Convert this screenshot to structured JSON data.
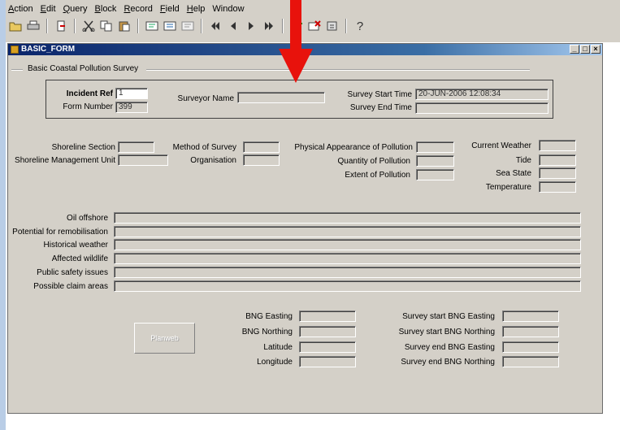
{
  "menubar": {
    "items": [
      {
        "label": "Action",
        "u": 0
      },
      {
        "label": "Edit",
        "u": 0
      },
      {
        "label": "Query",
        "u": 0
      },
      {
        "label": "Block",
        "u": 0
      },
      {
        "label": "Record",
        "u": 0
      },
      {
        "label": "Field",
        "u": 0
      },
      {
        "label": "Help",
        "u": 0
      },
      {
        "label": "Window",
        "u": -1
      }
    ]
  },
  "toolbar": {
    "help_glyph": "?"
  },
  "window": {
    "title": "BASIC_FORM",
    "min_glyph": "_",
    "max_glyph": "□",
    "close_glyph": "×"
  },
  "form": {
    "group_title": "Basic Coastal Pollution Survey",
    "incident": {
      "incident_ref_label": "Incident Ref",
      "incident_ref_value": "1",
      "form_number_label": "Form Number",
      "form_number_value": "399",
      "surveyor_name_label": "Surveyor Name",
      "surveyor_name_value": "",
      "survey_start_label": "Survey Start Time",
      "survey_start_value": "20-JUN-2006 12:08:34",
      "survey_end_label": "Survey End Time",
      "survey_end_value": ""
    },
    "labels": {
      "shoreline_section": "Shoreline Section",
      "shoreline_unit": "Shoreline Management Unit",
      "method_of_survey": "Method of Survey",
      "organisation": "Organisation",
      "physical_appearance": "Physical Appearance of Pollution",
      "quantity": "Quantity of Pollution",
      "extent": "Extent of Pollution",
      "current_weather": "Current Weather",
      "tide": "Tide",
      "sea_state": "Sea State",
      "temperature": "Temperature",
      "oil_offshore": "Oil offshore",
      "potential_remob": "Potential for remobilisation",
      "historical_weather": "Historical weather",
      "affected_wildlife": "Affected wildlife",
      "public_safety": "Public safety issues",
      "possible_claim": "Possible claim areas",
      "bng_easting": "BNG Easting",
      "bng_northing": "BNG Northing",
      "latitude": "Latitude",
      "longitude": "Longitude",
      "start_bng_easting": "Survey start BNG Easting",
      "start_bng_northing": "Survey start BNG Northing",
      "end_bng_easting": "Survey end BNG Easting",
      "end_bng_northing": "Survey end BNG Northing"
    },
    "planweb_label": "Planweb"
  },
  "colors": {
    "accent_arrow": "#e8120c",
    "titlebar": "#0a246a"
  }
}
